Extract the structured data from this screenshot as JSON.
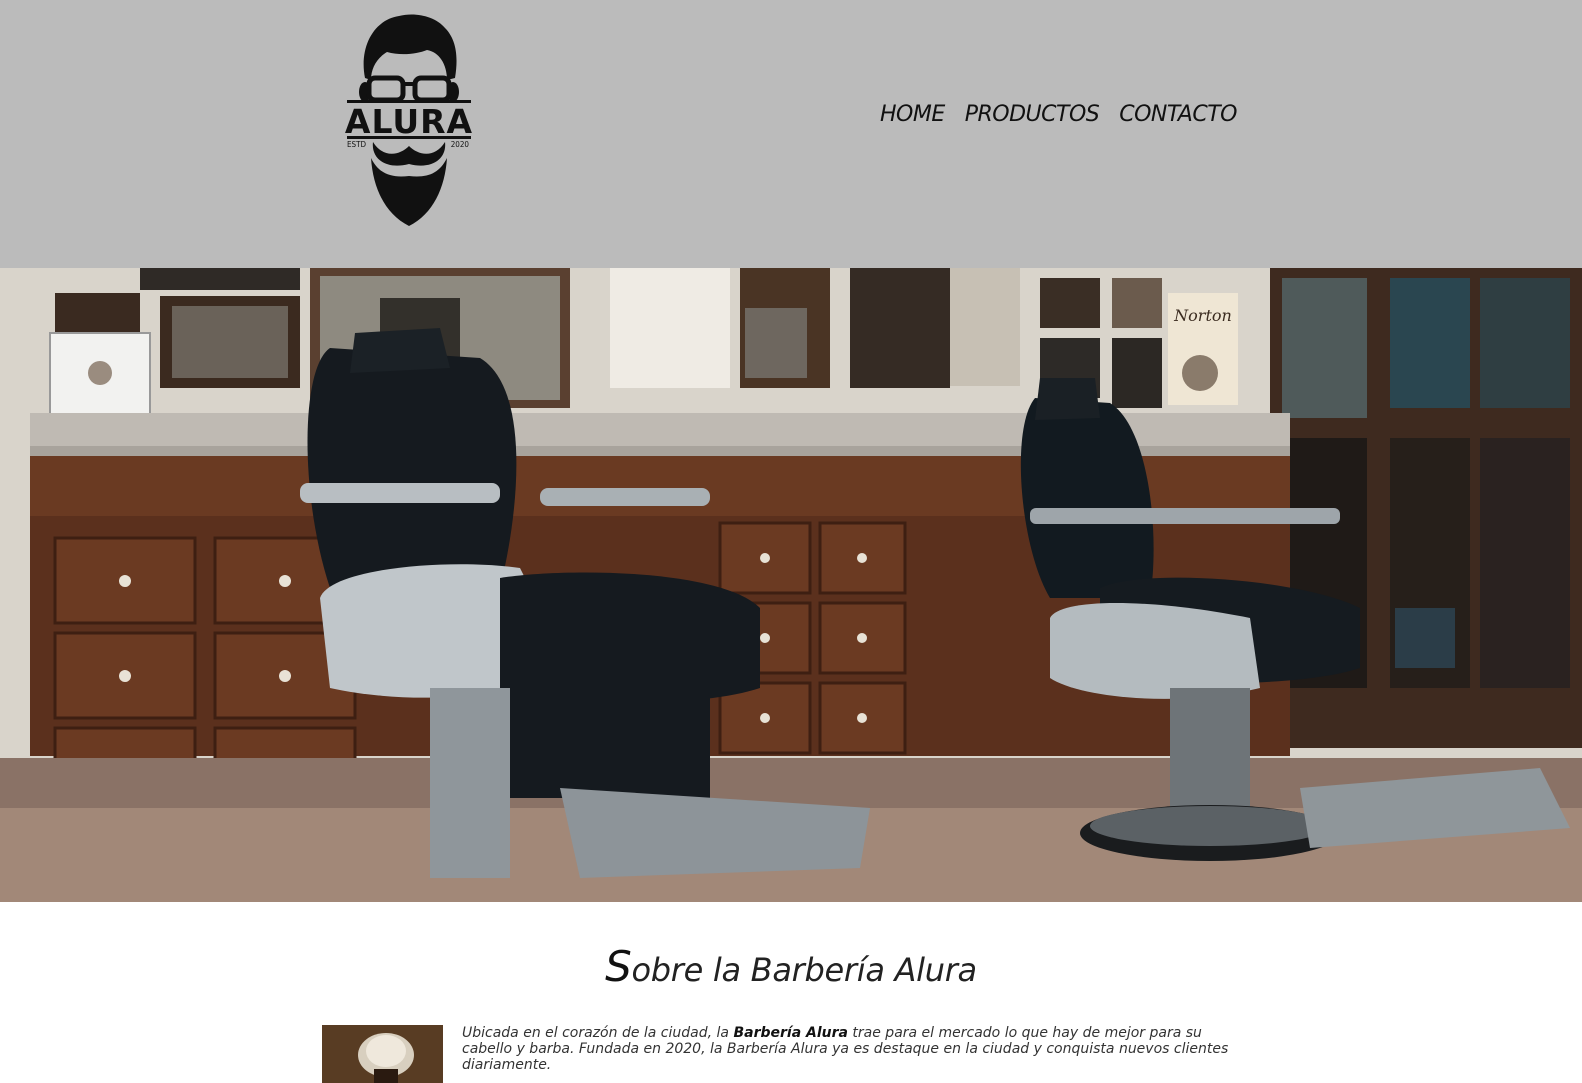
{
  "brand": {
    "name": "ALURA",
    "estd": "ESTD",
    "year": "2020"
  },
  "nav": {
    "home": "HOME",
    "productos": "PRODUCTOS",
    "contacto": "CONTACTO"
  },
  "hero": {
    "sign_text": "Norton"
  },
  "about": {
    "title_first": "S",
    "title_rest": "obre la Barbería Alura",
    "text_before": "Ubicada en el corazón de la ciudad, la ",
    "text_bold": "Barbería Alura",
    "text_after": " trae para el mercado lo que hay de mejor para su cabello y barba. Fundada en 2020, la Barbería Alura ya es destaque en la ciudad y conquista nuevos clientes diariamente."
  },
  "colors": {
    "header_bg": "#bbbbbb",
    "text": "#111111"
  },
  "icons": {
    "logo": "bearded-man-with-glasses-logo"
  }
}
